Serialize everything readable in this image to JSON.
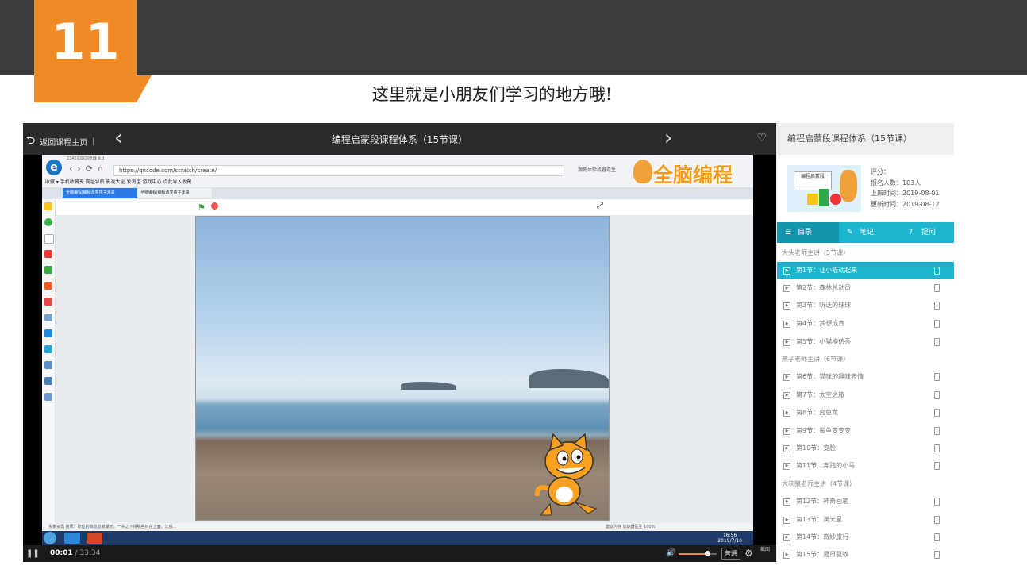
{
  "slide": {
    "number": "11",
    "caption": "这里就是小朋友们学习的地方哦!"
  },
  "player": {
    "back_label": "返回课程主页",
    "title": "编程启蒙段课程体系（15节课）",
    "current_time": "00:01",
    "duration": "/ 33:34",
    "quality": "普通",
    "screenshot_label": "截图",
    "volume_percent": 85
  },
  "screen": {
    "browser_name": "2345加速浏览器 9.0",
    "url": "https://qncode.com/scratch/create/",
    "search_hint": "濒死体验机器奇生",
    "bookmarks": "收藏 ▾  手机收藏夹  网址导航  影视大全  爱淘宝  游戏中心  点此导入收藏",
    "tab1": "全脑编程|编程改变孩子未来",
    "tab2": "全脑编程|编程改变孩子未来",
    "logo_text": "全脑编程",
    "status_text": "头条资讯  简讯：职位的消息息被曝光，一共之下将哪些林在上面，次后...",
    "status_right": "建议内存   加速器医生   100%",
    "clock_time": "16:56",
    "clock_date": "2019/7/10"
  },
  "panel": {
    "title": "编程启蒙段课程体系（15节课）",
    "thumb_label": "编程启蒙段",
    "rating_label": "评分：",
    "enrolled": "报名人数：103人",
    "published": "上架时间：2019-08-01",
    "updated": "更新时间：2019-08-12",
    "tabs": [
      "目录",
      "笔记",
      "提问"
    ],
    "chapters": [
      "大头老师主讲（5节课）",
      "燕子老师主讲（6节课）",
      "大灰狼老师主讲（4节课）"
    ],
    "lessons": [
      "第1节：让小猫动起来",
      "第2节：森林总动员",
      "第3节：听话的球球",
      "第4节：梦想成真",
      "第5节：小猫模仿秀",
      "第6节：猫咪的趣味表情",
      "第7节：太空之旅",
      "第8节：变色龙",
      "第9节：鲨鱼变变变",
      "第10节：变脸",
      "第11节：奔跑的小马",
      "第12节：神奇画笔",
      "第13节：满天星",
      "第14节：奇妙旅行",
      "第15节：夏日驱蚊"
    ]
  }
}
